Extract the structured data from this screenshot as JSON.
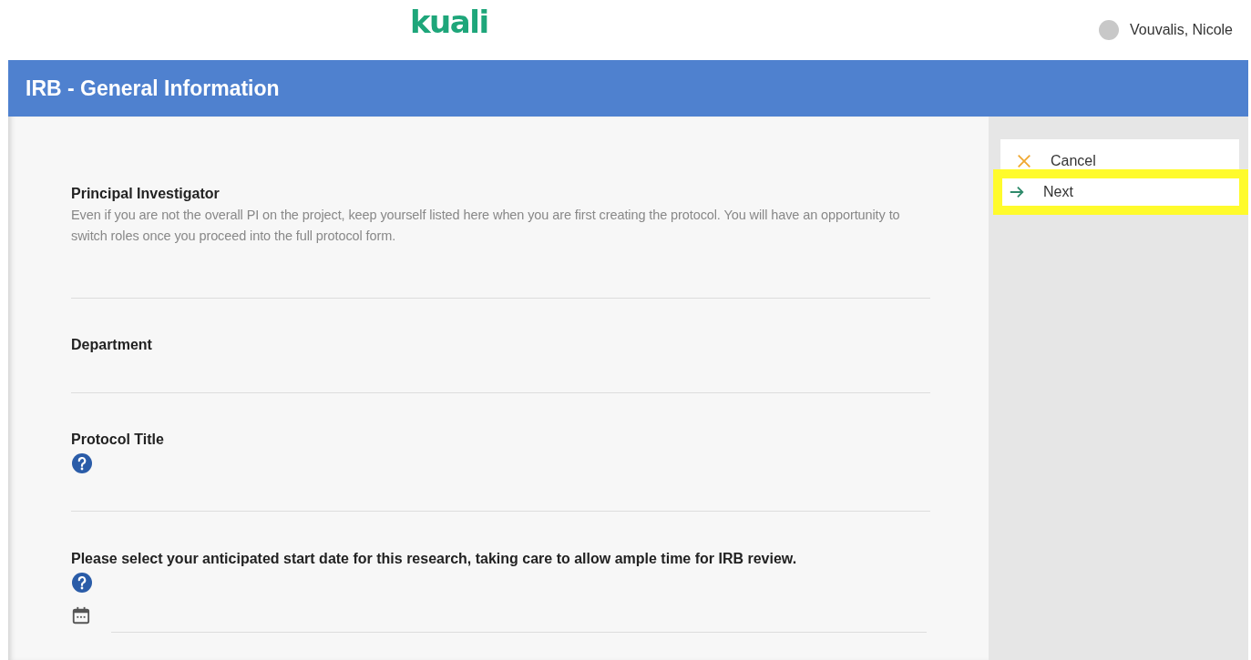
{
  "header": {
    "logo": "kuali",
    "user": "Vouvalis, Nicole"
  },
  "title_bar": {
    "title": "IRB - General Information"
  },
  "fields": [
    {
      "kind": "text",
      "label": "Principal Investigator",
      "description": "Even if you are not the overall PI on the project, keep yourself listed here when you are first creating the protocol. You will have an opportunity to switch roles once you proceed into the full protocol form.",
      "help": false
    },
    {
      "kind": "text",
      "label": "Department",
      "help": false
    },
    {
      "kind": "text",
      "label": "Protocol Title",
      "help": true
    },
    {
      "kind": "date",
      "label": "Please select your anticipated start date for this research, taking care to allow ample time for IRB review.",
      "help": true
    }
  ],
  "actions": [
    {
      "kind": "cancel",
      "label": "Cancel",
      "highlighted": false
    },
    {
      "kind": "next",
      "label": "Next",
      "highlighted": true
    }
  ]
}
